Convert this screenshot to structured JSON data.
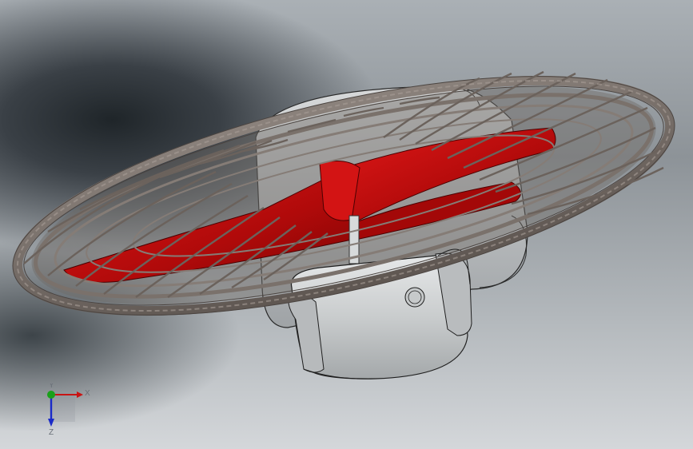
{
  "viewport": {
    "background_top": "#8d9398",
    "background_dark": "#1f2529",
    "background_bottom": "#d4d7da"
  },
  "model": {
    "guard_color": "#6e6560",
    "blade_color": "#c21010",
    "motor_color": "#c9cccd"
  },
  "triad": {
    "x_label": "X",
    "y_label": "Y",
    "z_label": "Z",
    "x_color": "#c81414",
    "y_color": "#1aa01a",
    "z_color": "#1a2ac8"
  }
}
